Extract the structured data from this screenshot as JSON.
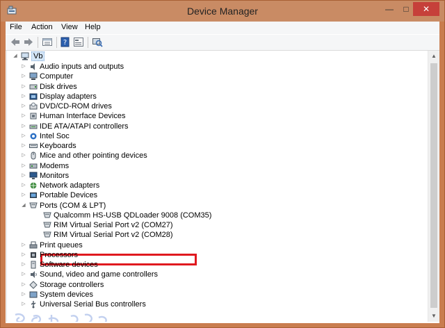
{
  "window": {
    "title": "Device Manager",
    "minimize_glyph": "—",
    "maximize_glyph": "□",
    "close_glyph": "✕"
  },
  "menu": [
    "File",
    "Action",
    "View",
    "Help"
  ],
  "toolbar": {
    "icons": [
      "back-icon",
      "forward-icon",
      "properties-icon",
      "help-icon",
      "show-hide-icon",
      "scan-hardware-icon"
    ]
  },
  "tree": {
    "root": "Vb",
    "categories": [
      {
        "label": "Audio inputs and outputs",
        "icon": "speaker-icon"
      },
      {
        "label": "Computer",
        "icon": "computer-icon"
      },
      {
        "label": "Disk drives",
        "icon": "disk-drive-icon"
      },
      {
        "label": "Display adapters",
        "icon": "display-adapter-icon"
      },
      {
        "label": "DVD/CD-ROM drives",
        "icon": "dvd-drive-icon"
      },
      {
        "label": "Human Interface Devices",
        "icon": "hid-icon"
      },
      {
        "label": "IDE ATA/ATAPI controllers",
        "icon": "ide-controller-icon"
      },
      {
        "label": "Intel Soc",
        "icon": "intel-soc-icon"
      },
      {
        "label": "Keyboards",
        "icon": "keyboard-icon"
      },
      {
        "label": "Mice and other pointing devices",
        "icon": "mouse-icon"
      },
      {
        "label": "Modems",
        "icon": "modem-icon"
      },
      {
        "label": "Monitors",
        "icon": "monitor-icon"
      },
      {
        "label": "Network adapters",
        "icon": "network-adapter-icon"
      },
      {
        "label": "Portable Devices",
        "icon": "portable-device-icon"
      },
      {
        "label": "Ports (COM & LPT)",
        "icon": "port-icon",
        "expanded": true
      }
    ],
    "ports_children": [
      "Qualcomm HS-USB QDLoader 9008 (COM35)",
      "RIM Virtual Serial Port v2 (COM27)",
      "RIM Virtual Serial Port v2 (COM28)"
    ],
    "categories_after": [
      {
        "label": "Print queues",
        "icon": "printer-icon"
      },
      {
        "label": "Processors",
        "icon": "processor-icon"
      },
      {
        "label": "Software devices",
        "icon": "software-device-icon"
      },
      {
        "label": "Sound, video and game controllers",
        "icon": "sound-icon"
      },
      {
        "label": "Storage controllers",
        "icon": "storage-controller-icon"
      },
      {
        "label": "System devices",
        "icon": "system-device-icon"
      },
      {
        "label": "Universal Serial Bus controllers",
        "icon": "usb-icon"
      }
    ]
  },
  "watermark": "Pro·Gsm·Doc",
  "colors": {
    "frame": "#c97d4f",
    "close_button": "#c6403a",
    "highlight_box": "#e0191f",
    "selection": "#d5e7f8"
  }
}
